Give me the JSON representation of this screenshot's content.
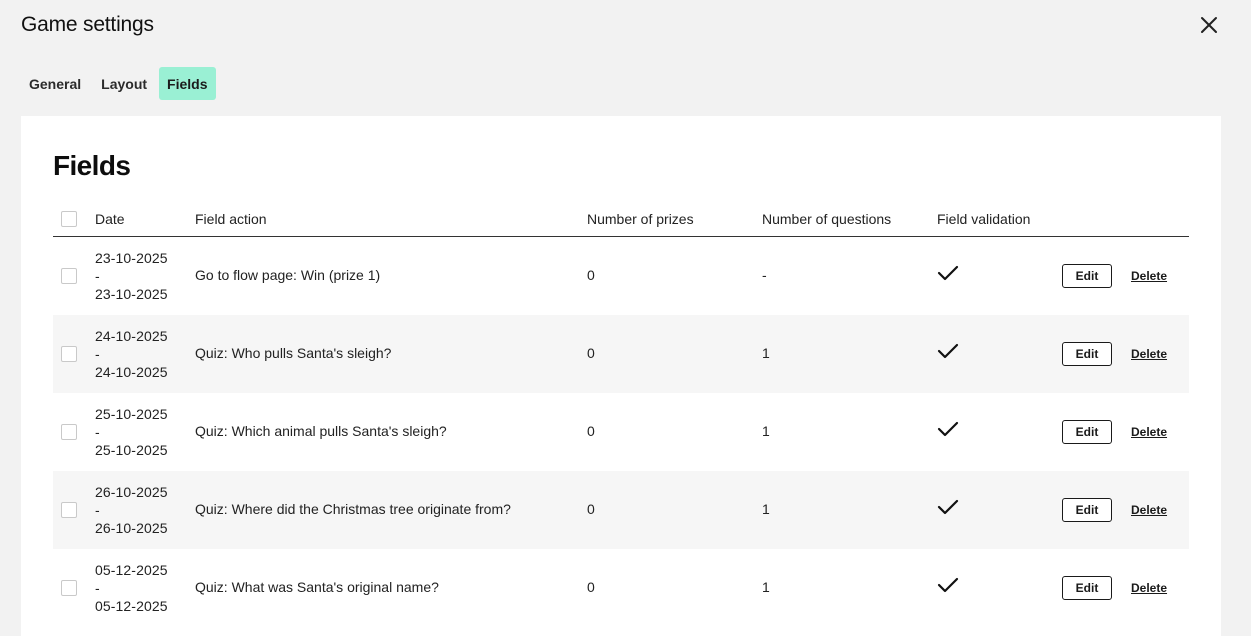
{
  "modal": {
    "title": "Game settings",
    "close_icon": "close-icon"
  },
  "tabs": [
    {
      "label": "General",
      "active": false
    },
    {
      "label": "Layout",
      "active": false
    },
    {
      "label": "Fields",
      "active": true
    }
  ],
  "colors": {
    "active_tab": "#9af0d4",
    "page_background": "#f2f2f2",
    "panel_background": "#ffffff",
    "alt_row": "#f6f6f6"
  },
  "panel": {
    "title": "Fields"
  },
  "table": {
    "headers": {
      "date": "Date",
      "field_action": "Field action",
      "number_of_prizes": "Number of prizes",
      "number_of_questions": "Number of questions",
      "field_validation": "Field validation"
    },
    "rows": [
      {
        "date_start": "23-10-2025",
        "date_sep": "-",
        "date_end": "23-10-2025",
        "field_action": "Go to flow page: Win (prize 1)",
        "prizes": "0",
        "questions": "-",
        "validated": true,
        "edit_label": "Edit",
        "delete_label": "Delete"
      },
      {
        "date_start": "24-10-2025",
        "date_sep": "-",
        "date_end": "24-10-2025",
        "field_action": "Quiz: Who pulls Santa's sleigh?",
        "prizes": "0",
        "questions": "1",
        "validated": true,
        "edit_label": "Edit",
        "delete_label": "Delete"
      },
      {
        "date_start": "25-10-2025",
        "date_sep": "-",
        "date_end": "25-10-2025",
        "field_action": "Quiz: Which animal pulls Santa's sleigh?",
        "prizes": "0",
        "questions": "1",
        "validated": true,
        "edit_label": "Edit",
        "delete_label": "Delete"
      },
      {
        "date_start": "26-10-2025",
        "date_sep": "-",
        "date_end": "26-10-2025",
        "field_action": "Quiz: Where did the Christmas tree originate from?",
        "prizes": "0",
        "questions": "1",
        "validated": true,
        "edit_label": "Edit",
        "delete_label": "Delete"
      },
      {
        "date_start": "05-12-2025",
        "date_sep": "-",
        "date_end": "05-12-2025",
        "field_action": "Quiz: What was Santa's original name?",
        "prizes": "0",
        "questions": "1",
        "validated": true,
        "edit_label": "Edit",
        "delete_label": "Delete"
      }
    ]
  }
}
